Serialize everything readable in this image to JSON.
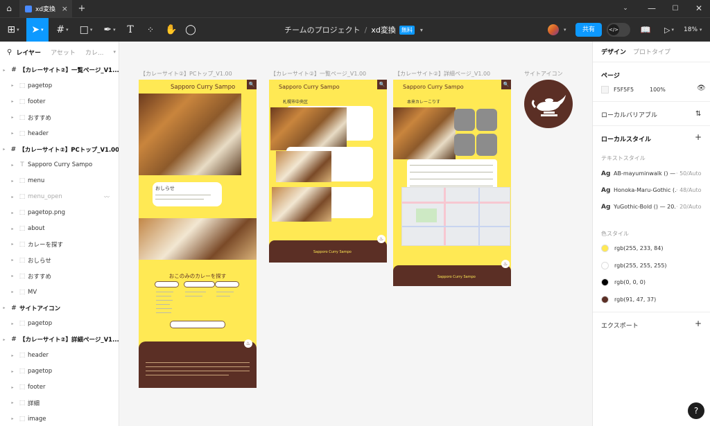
{
  "tabbar": {
    "file_tab": "xd変換",
    "close": "×",
    "new_tab": "+",
    "home": "⌂",
    "win_chevron": "⌄",
    "win_min": "—",
    "win_max": "☐",
    "win_close": "✕"
  },
  "toolbar": {
    "figma_icon": "⊞",
    "move_icon": "➤",
    "frame_icon": "#",
    "shape_icon": "□",
    "pen_icon": "✒",
    "text_icon": "T",
    "resources_icon": "⁘",
    "hand_icon": "✋",
    "comment_icon": "◯",
    "dropdown": "▾",
    "project": "チームのプロジェクト",
    "separator": "/",
    "file_name": "xd変換",
    "plan_badge": "無料",
    "share_label": "共有",
    "devmode_icon": "</>",
    "library_icon": "📖",
    "present_icon": "▷",
    "zoom": "18%"
  },
  "left_panel": {
    "search_icon": "⚲",
    "tabs": [
      "レイヤー",
      "アセット",
      "カレ..."
    ],
    "layers": [
      {
        "name": "【カレーサイト②】一覧ページ_V1...",
        "level": 0
      },
      {
        "name": "pagetop",
        "level": 1
      },
      {
        "name": "footer",
        "level": 1
      },
      {
        "name": "おすすめ",
        "level": 1
      },
      {
        "name": "header",
        "level": 1
      },
      {
        "name": "【カレーサイト②】PCトップ_V1.00",
        "level": 0
      },
      {
        "name": "Sapporo Curry Sampo",
        "level": 1,
        "icon": "T"
      },
      {
        "name": "menu",
        "level": 1
      },
      {
        "name": "menu_open",
        "level": 1,
        "dim": true,
        "extra": "〰"
      },
      {
        "name": "pagetop.png",
        "level": 1
      },
      {
        "name": "about",
        "level": 1
      },
      {
        "name": "カレーを探す",
        "level": 1
      },
      {
        "name": "おしらせ",
        "level": 1
      },
      {
        "name": "おすすめ",
        "level": 1
      },
      {
        "name": "MV",
        "level": 1
      },
      {
        "name": "サイトアイコン",
        "level": 0
      },
      {
        "name": "pagetop",
        "level": 1
      },
      {
        "name": "【カレーサイト②】詳細ページ_V1...",
        "level": 0
      },
      {
        "name": "header",
        "level": 1
      },
      {
        "name": "pagetop",
        "level": 1
      },
      {
        "name": "footer",
        "level": 1
      },
      {
        "name": "詳細",
        "level": 1
      },
      {
        "name": "image",
        "level": 1
      }
    ]
  },
  "canvas": {
    "frame_labels": {
      "pc_top": "【カレーサイト②】PCトップ_V1.00",
      "list": "【カレーサイト②】一覧ページ_V1.00",
      "detail": "【カレーサイト②】詳細ページ_V1.00",
      "site_icon": "サイトアイコン"
    },
    "pc_top": {
      "title": "Sapporo Curry Sampo",
      "news": "おしらせ",
      "pick": "おこのみのカレーを探す",
      "search_icon": "🔍"
    },
    "list": {
      "title": "Sapporo Curry Sampo",
      "area": "札幌市中央区",
      "footer_title": "Sapporo Curry Sampo"
    },
    "detail": {
      "title": "Sapporo Curry Sampo",
      "shop": "本来カレーこりす",
      "footer_title": "Sapporo Curry Sampo"
    }
  },
  "right_panel": {
    "tabs": [
      "デザイン",
      "プロトタイプ"
    ],
    "page_section": "ページ",
    "page_color": "F5F5F5",
    "page_opacity": "100%",
    "eye_icon": "👁",
    "local_variables": "ローカルバリアブル",
    "adjust_icon": "⇅",
    "local_styles": "ローカルスタイル",
    "plus": "+",
    "text_styles_label": "テキストスタイル",
    "text_styles": [
      {
        "ag": "Ag",
        "name": "AB-mayuminwalk () —",
        "meta": "· 50/Auto"
      },
      {
        "ag": "Ag",
        "name": "Honoka-Maru-Gothic (...",
        "meta": "· 48/Auto"
      },
      {
        "ag": "Ag",
        "name": "YuGothic-Bold () — 20...",
        "meta": "· 20/Auto"
      }
    ],
    "color_styles_label": "色スタイル",
    "color_styles": [
      {
        "name": "rgb(255, 233, 84)",
        "color": "#ffe954"
      },
      {
        "name": "rgb(255, 255, 255)",
        "color": "#ffffff"
      },
      {
        "name": "rgb(0, 0, 0)",
        "color": "#000000"
      },
      {
        "name": "rgb(91, 47, 37)",
        "color": "#5b2f25"
      }
    ],
    "export_label": "エクスポート"
  },
  "help": "?"
}
